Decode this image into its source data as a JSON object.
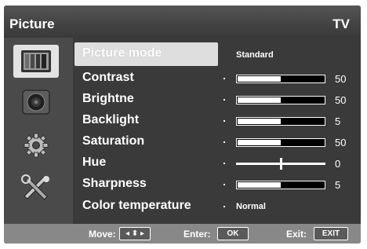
{
  "header": {
    "title": "Picture",
    "source": "TV"
  },
  "sidebar": {
    "items": [
      {
        "icon": "picture-icon",
        "active": true
      },
      {
        "icon": "sound-icon",
        "active": false
      },
      {
        "icon": "settings-icon",
        "active": false
      },
      {
        "icon": "tools-icon",
        "active": false
      }
    ]
  },
  "menu": {
    "picture_mode": {
      "label": "Picture mode",
      "value": "Standard"
    },
    "contrast": {
      "label": "Contrast",
      "value": "50",
      "level": 0.5
    },
    "brightness": {
      "label": "Brightne",
      "value": "50",
      "level": 0.5
    },
    "backlight": {
      "label": "Backlight",
      "value": "5",
      "level": 0.5
    },
    "saturation": {
      "label": "Saturation",
      "value": "50",
      "level": 0.5
    },
    "hue": {
      "label": "Hue",
      "value": "0",
      "level": 0.5
    },
    "sharpness": {
      "label": "Sharpness",
      "value": "5",
      "level": 0.5
    },
    "color_temperature": {
      "label": "Color temperature",
      "value": "Normal"
    }
  },
  "footer": {
    "move_label": "Move:",
    "move_key": "◂ ⬍ ▸",
    "enter_label": "Enter:",
    "enter_key": "OK",
    "exit_label": "Exit:",
    "exit_key": "EXIT"
  },
  "colors": {
    "panel": "#3a3a3a",
    "sidebar": "#4a4a4a",
    "selection": "#dedede",
    "footer": "#888888"
  }
}
